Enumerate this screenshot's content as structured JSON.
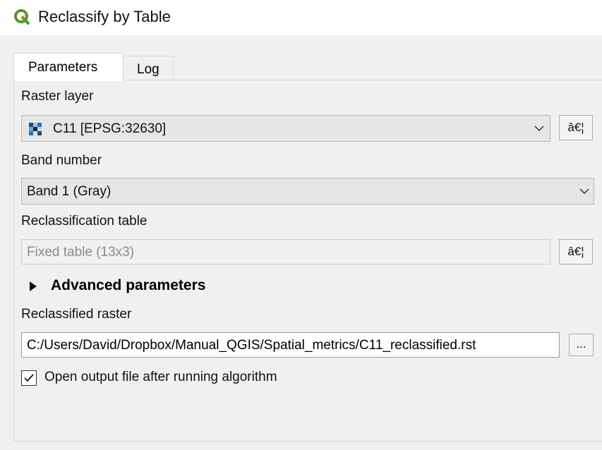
{
  "window": {
    "title": "Reclassify by Table",
    "icon": "qgis-logo-icon"
  },
  "tabs": [
    {
      "label": "Parameters",
      "active": true
    },
    {
      "label": "Log",
      "active": false
    }
  ],
  "params": {
    "raster_layer_label": "Raster layer",
    "raster_layer_value": "C11 [EPSG:32630]",
    "raster_layer_button": "â€¦",
    "band_label": "Band number",
    "band_value": "Band 1 (Gray)",
    "reclass_table_label": "Reclassification table",
    "reclass_table_value": "Fixed table (13x3)",
    "reclass_table_button": "â€¦",
    "advanced_label": "Advanced parameters",
    "output_label": "Reclassified raster",
    "output_value": "C:/Users/David/Dropbox/Manual_QGIS/Spatial_metrics/C11_reclassified.rst",
    "output_button": "...",
    "open_output_label": "Open output file after running algorithm",
    "open_output_checked": true
  },
  "colors": {
    "qgis_green": "#589632",
    "qgis_yellow": "#ee7913",
    "dialog_bg": "#f0f0f0"
  }
}
